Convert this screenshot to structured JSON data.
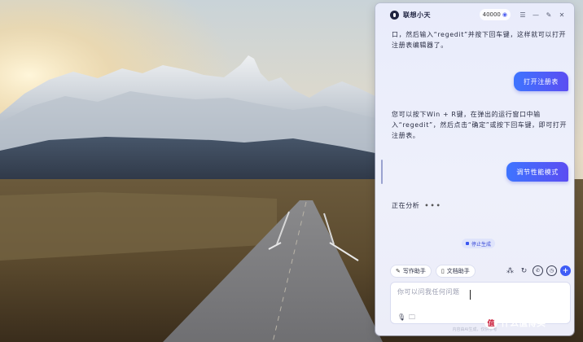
{
  "window": {
    "app_title": "联想小天",
    "credits": "40000",
    "credits_icon": "coin-icon",
    "controls": [
      "menu-icon",
      "minimize-icon",
      "pin-icon",
      "close-icon"
    ]
  },
  "chat": {
    "messages": [
      {
        "role": "assistant",
        "text": "口，然后输入“regedit”并按下回车键，这样就可以打开注册表编辑器了。"
      },
      {
        "role": "user",
        "text": "打开注册表"
      },
      {
        "role": "assistant",
        "text": "您可以按下Win + R键，在弹出的运行窗口中输入“regedit”，然后点击“确定”或按下回车键，即可打开注册表。"
      },
      {
        "role": "user",
        "text": "调节性能模式"
      }
    ],
    "status_text": "正在分析",
    "status_dots": "•••",
    "stop_label": "停止生成"
  },
  "toolbar": {
    "chips": [
      {
        "label": "写作助手",
        "icon": "pen-icon"
      },
      {
        "label": "文档助手",
        "icon": "document-icon"
      }
    ],
    "icons": [
      "apps-icon",
      "refresh-icon",
      "phone-icon",
      "history-icon",
      "plus-icon"
    ]
  },
  "input": {
    "placeholder": "你可以问我任何问题",
    "icons": [
      "microphone-icon",
      "folder-icon"
    ]
  },
  "footer": {
    "text": "内容由AI生成，仅供参考"
  },
  "watermark": {
    "text": "什么值得买",
    "badge": "值"
  },
  "colors": {
    "accent": "#4a5cf0",
    "user_bubble_start": "#3e74ff",
    "user_bubble_end": "#5b4df2"
  }
}
